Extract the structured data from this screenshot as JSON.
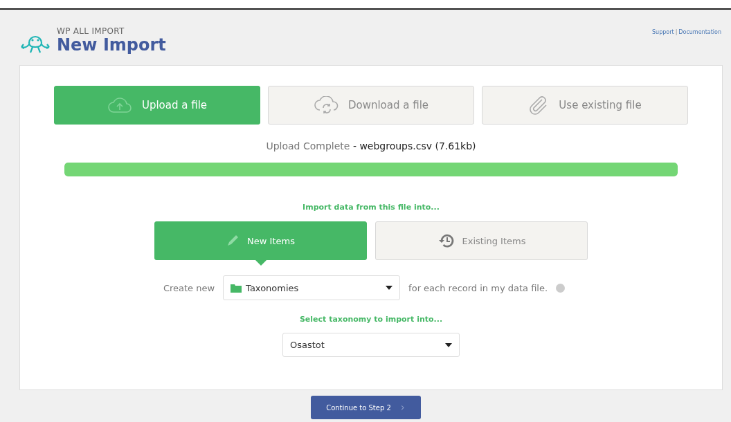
{
  "header": {
    "brand": "WP ALL IMPORT",
    "title": "New Import",
    "links": [
      "Support",
      "Documentation"
    ],
    "link_separator": "|"
  },
  "source_tabs": [
    {
      "kind": "upload",
      "label": "Upload a file",
      "selected": true
    },
    {
      "kind": "download",
      "label": "Download a file",
      "selected": false
    },
    {
      "kind": "existing",
      "label": "Use existing file",
      "selected": false
    }
  ],
  "upload_status": {
    "label": "Upload Complete",
    "detail": "- webgroups.csv (7.61kb)"
  },
  "progress": {
    "level": 1
  },
  "import_into": {
    "heading": "Import data from this file into...",
    "options": [
      {
        "kind": "new",
        "label": "New Items",
        "selected": true
      },
      {
        "kind": "existing",
        "label": "Existing Items",
        "selected": false
      }
    ]
  },
  "create_row": {
    "prefix": "Create new",
    "value": "Taxonomies",
    "suffix": "for each record in my data file."
  },
  "taxonomy": {
    "heading": "Select taxonomy to import into...",
    "value": "Osastot"
  },
  "continue_button": {
    "label": "Continue to Step 2",
    "arrow": "›"
  }
}
